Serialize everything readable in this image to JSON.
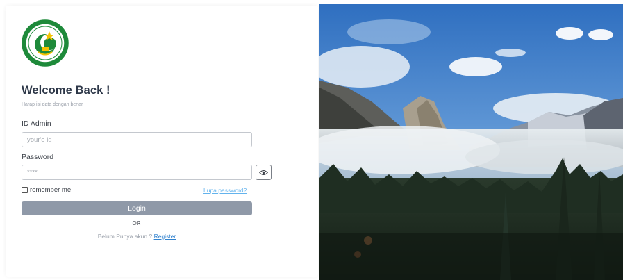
{
  "logo": {
    "icon": "school-emblem-icon",
    "colors": {
      "primary": "#1e8a3a",
      "accent": "#f2c200"
    }
  },
  "login": {
    "title": "Welcome Back !",
    "subtitle": "Harap isi data dengan benar",
    "id_label": "ID Admin",
    "id_placeholder": "your'e id",
    "password_label": "Password",
    "password_placeholder": "****",
    "show_password_icon": "eye-icon",
    "remember_label": "remember me",
    "forgot_link": "Lupa password?",
    "login_button": "Login",
    "divider_text": "OR",
    "register_prompt": "Belum Punya akun ? ",
    "register_link": "Register"
  },
  "hero": {
    "image": "mountain-valley-landscape"
  },
  "colors": {
    "login_button": "#8f99a8",
    "link": "#3182ce",
    "forgot_link": "#63b3ed",
    "title": "#2d3748"
  }
}
